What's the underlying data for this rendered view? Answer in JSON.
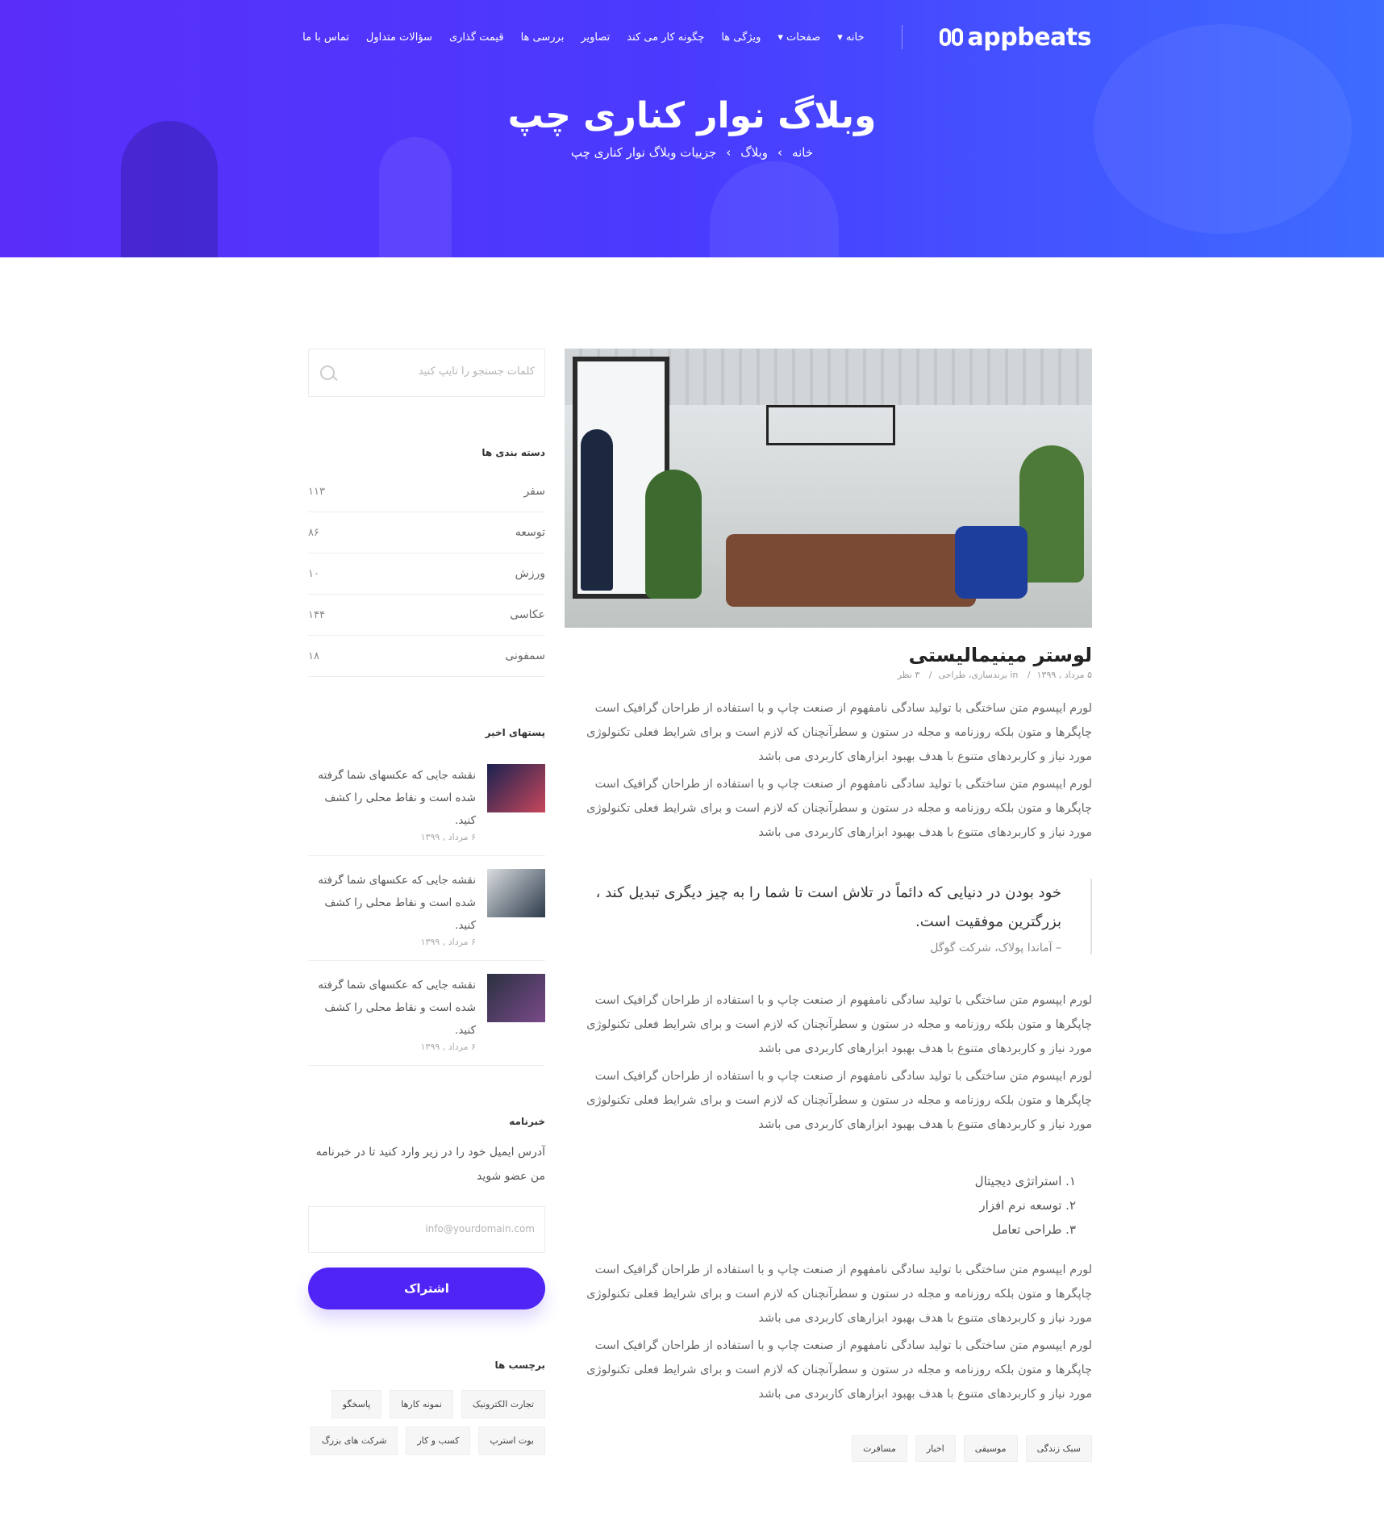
{
  "brand": {
    "name": "appbeats"
  },
  "nav": {
    "items": [
      "خانه",
      "صفحات",
      "ویژگی ها",
      "چگونه کار می کند",
      "تصاویر",
      "بررسی ها",
      "قیمت گذاری",
      "سؤالات متداول",
      "تماس با ما"
    ]
  },
  "hero": {
    "title": "وبلاگ نوار کناری چپ",
    "breadcrumb": [
      "خانه",
      "وبلاگ",
      "جزییات وبلاگ نوار کناری چپ"
    ],
    "breadcrumb_sep": "›"
  },
  "post": {
    "title": "لوستر مینیمالیستی",
    "meta": {
      "date": "۵ مرداد , ۱۳۹۹",
      "categories": "in برندسازی، طراحی",
      "views": "۳ نظر",
      "sep": "/"
    },
    "paragraph": "لورم ایپسوم متن ساختگی با تولید سادگی نامفهوم از صنعت چاپ و با استفاده از طراحان گرافیک است چاپگرها و متون بلکه روزنامه و مجله در ستون و سطرآنچنان که لازم است و برای شرایط فعلی تکنولوژی مورد نیاز و کاربردهای متنوع با هدف بهبود ابزارهای کاربردی می باشد",
    "quote": {
      "text": "خود بودن در دنیایی که دائماً در تلاش است تا شما را به چیز دیگری تبدیل کند ، بزرگترین موفقیت است.",
      "author": "– آماندا پولاک، شرکت گوگل"
    },
    "list": [
      "۱. استراتژی دیجیتال",
      "۲. توسعه نرم افزار",
      "۳. طراحی تعامل"
    ],
    "tags": [
      "سبک زندگی",
      "موسیقی",
      "اخبار",
      "مسافرت"
    ]
  },
  "sidebar": {
    "search_placeholder": "کلمات جستجو را تایپ کنید",
    "categories": {
      "title": "دسته بندی ها",
      "items": [
        {
          "name": "سفر",
          "count": "۱۱۳"
        },
        {
          "name": "توسعه",
          "count": "۸۶"
        },
        {
          "name": "ورزش",
          "count": "۱۰"
        },
        {
          "name": "عکاسی",
          "count": "۱۴۴"
        },
        {
          "name": "سمفونی",
          "count": "۱۸"
        }
      ]
    },
    "recent": {
      "title": "پستهای اخیر",
      "items": [
        {
          "text": "نقشه جایی که عکسهای شما گرفته شده است و نقاط محلی را کشف کنید.",
          "date": "۶ مرداد , ۱۳۹۹"
        },
        {
          "text": "نقشه جایی که عکسهای شما گرفته شده است و نقاط محلی را کشف کنید.",
          "date": "۶ مرداد , ۱۳۹۹"
        },
        {
          "text": "نقشه جایی که عکسهای شما گرفته شده است و نقاط محلی را کشف کنید.",
          "date": "۶ مرداد , ۱۳۹۹"
        }
      ]
    },
    "newsletter": {
      "title": "خبرنامه",
      "text": "آدرس ایمیل خود را در زیر وارد کنید تا در خبرنامه من عضو شوید",
      "email_placeholder": "info@yourdomain.com",
      "button": "اشتراک"
    },
    "tags": {
      "title": "برچسب ها",
      "items": [
        "تجارت الکترونیک",
        "نمونه کارها",
        "پاسخگو",
        "بوت استرپ",
        "کسب و کار",
        "شرکت های بزرگ"
      ]
    }
  },
  "colors": {
    "accent": "#4f24f5",
    "hero_start": "#5a2ef8",
    "hero_end": "#3d6cff"
  }
}
